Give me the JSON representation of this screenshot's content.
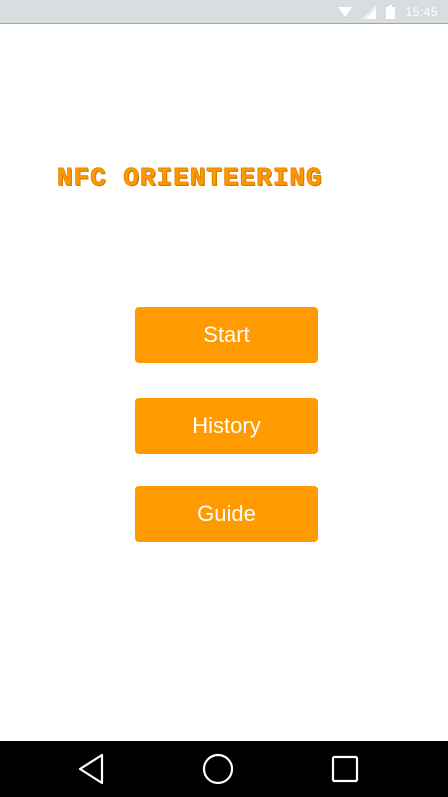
{
  "status_bar": {
    "time": "15:45",
    "icons": [
      "wifi-icon",
      "signal-icon",
      "battery-icon"
    ]
  },
  "app": {
    "title": "NFC ORIENTEERING",
    "accent_color": "#ff9a00"
  },
  "menu": {
    "start_label": "Start",
    "history_label": "History",
    "guide_label": "Guide"
  },
  "nav_bar": {
    "icons": [
      "back-icon",
      "home-icon",
      "recents-icon"
    ]
  }
}
